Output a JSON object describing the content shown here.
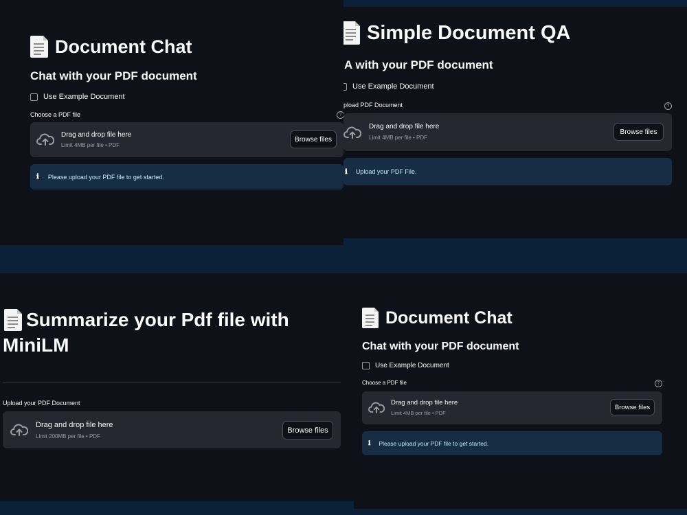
{
  "colors": {
    "background": "#0a2138",
    "panel": "#0e1117",
    "dropzone": "#262730",
    "info_alert": "#172d43",
    "info_text": "#c7ebff",
    "muted_text": "#9aa0a6"
  },
  "icons": {
    "title": "document-icon",
    "upload": "cloud-upload-icon",
    "info": "info-icon",
    "help": "question-circle-icon"
  },
  "panel_tl": {
    "title": "Document Chat",
    "subtitle": "Chat with your PDF document",
    "checkbox_label": "Use Example Document",
    "uploader_label": "Choose a PDF file",
    "help_glyph": "?",
    "dropzone_title": "Drag and drop file here",
    "dropzone_limit": "Limit 4MB per file • PDF",
    "browse_label": "Browse files",
    "info_glyph": "ℹ",
    "info_message": "Please upload your PDF file to get started."
  },
  "panel_tr": {
    "title": "Simple Document QA",
    "subtitle": "A with your PDF document",
    "checkbox_label": "Use Example Document",
    "uploader_label": "pload PDF Document",
    "help_glyph": "?",
    "dropzone_title": "Drag and drop file here",
    "dropzone_limit": "Limit 4MB per file • PDF",
    "browse_label": "Browse files",
    "info_glyph": "ℹ",
    "info_message": "Upload your PDF File."
  },
  "panel_bl": {
    "title_line1": "Summarize your Pdf file with",
    "title_line2": "MiniLM",
    "uploader_label": "Upload your PDF Document",
    "dropzone_title": "Drag and drop file here",
    "dropzone_limit": "Limit 200MB per file • PDF",
    "browse_label": "Browse files"
  },
  "panel_br": {
    "title": "Document Chat",
    "subtitle": "Chat with your PDF document",
    "checkbox_label": "Use Example Document",
    "uploader_label": "Choose a PDF file",
    "help_glyph": "?",
    "dropzone_title": "Drag and drop file here",
    "dropzone_limit": "Limit 4MB per file • PDF",
    "browse_label": "Browse files",
    "info_glyph": "ℹ",
    "info_message": "Please upload your PDF file to get started."
  }
}
